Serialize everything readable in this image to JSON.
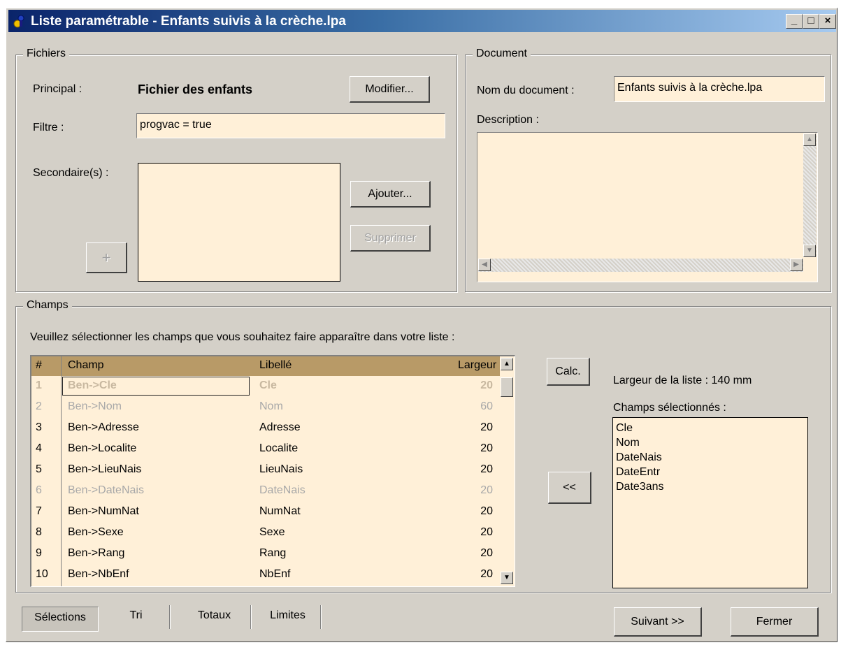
{
  "window": {
    "title": "Liste paramétrable - Enfants suivis à la crèche.lpa",
    "min_label": "_",
    "max_label": "□",
    "close_label": "×"
  },
  "fichiers": {
    "group_title": "Fichiers",
    "principal_label": "Principal :",
    "principal_value": "Fichier des enfants",
    "modify_button": "Modifier...",
    "filtre_label": "Filtre :",
    "filtre_value": "progvac = true",
    "secondaire_label": "Secondaire(s) :",
    "add_button": "Ajouter...",
    "remove_button": "Supprimer",
    "plus_button": "+"
  },
  "document": {
    "group_title": "Document",
    "nom_label": "Nom du document :",
    "nom_value": "Enfants suivis à la crèche.lpa",
    "description_label": "Description :",
    "description_value": ""
  },
  "champs": {
    "group_title": "Champs",
    "instruction": "Veuillez sélectionner les champs que vous souhaitez faire apparaître dans votre liste :",
    "headers": {
      "num": "#",
      "champ": "Champ",
      "libelle": "Libellé",
      "largeur": "Largeur"
    },
    "rows": [
      {
        "num": "1",
        "champ": "Ben->Cle",
        "libelle": "Cle",
        "largeur": "20",
        "state": "selected"
      },
      {
        "num": "2",
        "champ": "Ben->Nom",
        "libelle": "Nom",
        "largeur": "60",
        "state": "disabled"
      },
      {
        "num": "3",
        "champ": "Ben->Adresse",
        "libelle": "Adresse",
        "largeur": "20",
        "state": "normal"
      },
      {
        "num": "4",
        "champ": "Ben->Localite",
        "libelle": "Localite",
        "largeur": "20",
        "state": "normal"
      },
      {
        "num": "5",
        "champ": "Ben->LieuNais",
        "libelle": "LieuNais",
        "largeur": "20",
        "state": "normal"
      },
      {
        "num": "6",
        "champ": "Ben->DateNais",
        "libelle": "DateNais",
        "largeur": "20",
        "state": "disabled"
      },
      {
        "num": "7",
        "champ": "Ben->NumNat",
        "libelle": "NumNat",
        "largeur": "20",
        "state": "normal"
      },
      {
        "num": "8",
        "champ": "Ben->Sexe",
        "libelle": "Sexe",
        "largeur": "20",
        "state": "normal"
      },
      {
        "num": "9",
        "champ": "Ben->Rang",
        "libelle": "Rang",
        "largeur": "20",
        "state": "normal"
      },
      {
        "num": "10",
        "champ": "Ben->NbEnf",
        "libelle": "NbEnf",
        "largeur": "20",
        "state": "normal"
      }
    ],
    "calc_button": "Calc.",
    "remove_button": "<<",
    "largeur_liste": "Largeur de la liste : 140 mm",
    "selected_label": "Champs sélectionnés :",
    "selected_fields": [
      "Cle",
      "Nom",
      "DateNais",
      "DateEntr",
      "Date3ans"
    ]
  },
  "tabs": [
    {
      "label": "Sélections",
      "active": true
    },
    {
      "label": "Tri",
      "active": false
    },
    {
      "label": "Totaux",
      "active": false
    },
    {
      "label": "Limites",
      "active": false
    }
  ],
  "footer": {
    "next_button": "Suivant >>",
    "close_button": "Fermer"
  },
  "colors": {
    "field_bg": "#fff0d8",
    "header_bg": "#b89a67",
    "titlebar_start": "#0a246a",
    "titlebar_end": "#a6caf0",
    "dialog_bg": "#d4d0c8"
  }
}
